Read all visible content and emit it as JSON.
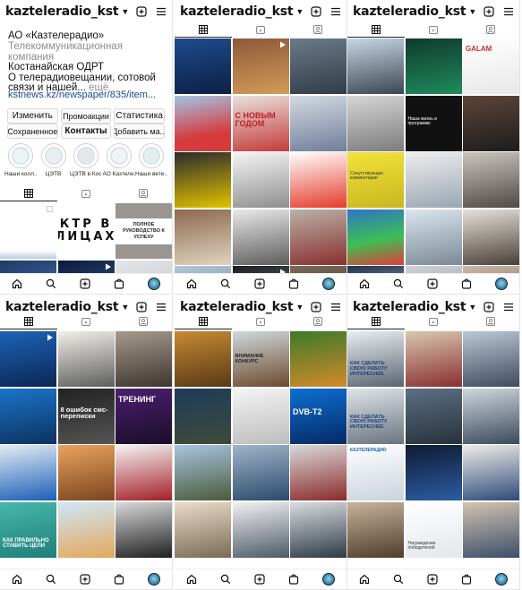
{
  "username": "kazteleradio_kst",
  "profile": {
    "name": "АО «Казтелерадио»",
    "category": "Телекоммуникационная компания",
    "location": "Костанайская ОДРТ",
    "bio": "О телерадиовещании, сотовой связи и нашей...",
    "bio_more": "ещё",
    "link": "kstnews.kz/newspaper/835/item...",
    "buttons_row1": [
      "Изменить",
      "Промоакции",
      "Статистика"
    ],
    "buttons_row2": [
      "Сохраненное",
      "Контакты",
      "Добавить ма..."
    ],
    "highlights": [
      {
        "label": "Наши колл..."
      },
      {
        "label": "ЦЭТВ"
      },
      {
        "label": "ЦЭТВ в Кос..."
      },
      {
        "label": "АО Казтеле..."
      },
      {
        "label": "Наши вете..."
      }
    ],
    "tiles": {
      "ktr": "КТР В ЛИЦАХ",
      "guide": "ПОЛНОЕ РУКОВОДСТВО К УСПЕХУ"
    }
  },
  "grid_texts": {
    "p1_newyear": "С НОВЫМ ГОДОМ",
    "p2_report": "Сопутствующие комментарии",
    "p2_note": "Наша жизнь в программе",
    "p2_galam": "GALAM",
    "p3_sms": "8 ошибок смс-переписки",
    "p3_training": "ТРЕНИНГ",
    "p3_goal": "КАК ПРАВИЛЬНО СТАВИТЬ ЦЕЛИ",
    "p4_notice": "ВНИМАНИЕ КОНКУРС",
    "p4_dvb": "DVB-T2",
    "p5_work1": "КАК СДЕЛАТЬ СВОЮ РАБОТУ ИНТЕРЕСНЕЕ",
    "p5_work2": "КАК СДЕЛАТЬ СВОЮ РАБОТУ ИНТЕРЕСНЕЕ",
    "p5_award": "Награждение победителей",
    "p5_brand": "КАЗТЕЛЕРАДИО"
  },
  "colors": {
    "text": "#111111",
    "muted": "#8e8e8e",
    "link": "#1a4a8a",
    "avatar": "#3b8fb3"
  },
  "icons": [
    "chevron-down-icon",
    "add-post-icon",
    "menu-icon",
    "grid-icon",
    "reels-icon",
    "tagged-icon",
    "home-icon",
    "search-icon",
    "create-icon",
    "shop-icon",
    "profile-avatar"
  ]
}
